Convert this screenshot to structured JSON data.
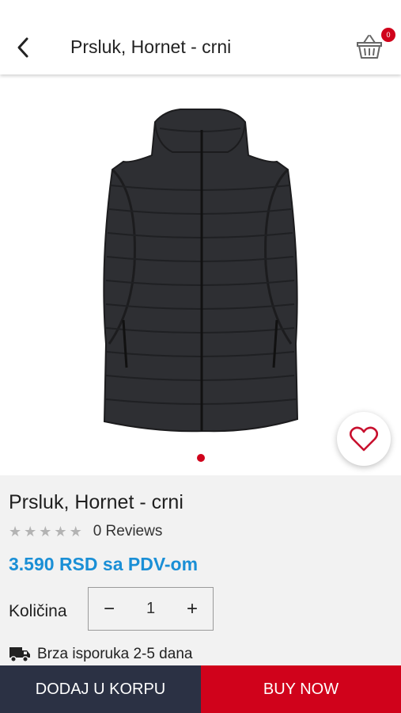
{
  "header": {
    "title": "Prsluk, Hornet - crni",
    "back_icon": "chevron-left-icon",
    "cart_icon": "basket-icon",
    "cart_count": "0"
  },
  "gallery": {
    "image_icon": "product-photo-vest",
    "active_dot_color": "#d0021b",
    "favorite_icon": "heart-outline-icon"
  },
  "product": {
    "name": "Prsluk, Hornet - crni",
    "rating": 0,
    "rating_max": 5,
    "reviews_label": "0 Reviews",
    "price": "3.590 RSD sa PDV-om",
    "price_color": "#1a8fd6"
  },
  "quantity": {
    "label": "Količina",
    "minus": "−",
    "value": "1",
    "plus": "+"
  },
  "delivery": {
    "icon": "truck-icon",
    "text": "Brza isporuka 2-5 dana"
  },
  "actions": {
    "add_to_cart": "DODAJ U KORPU",
    "buy_now": "BUY NOW",
    "add_color": "#2b3144",
    "buy_color": "#d0021b"
  }
}
